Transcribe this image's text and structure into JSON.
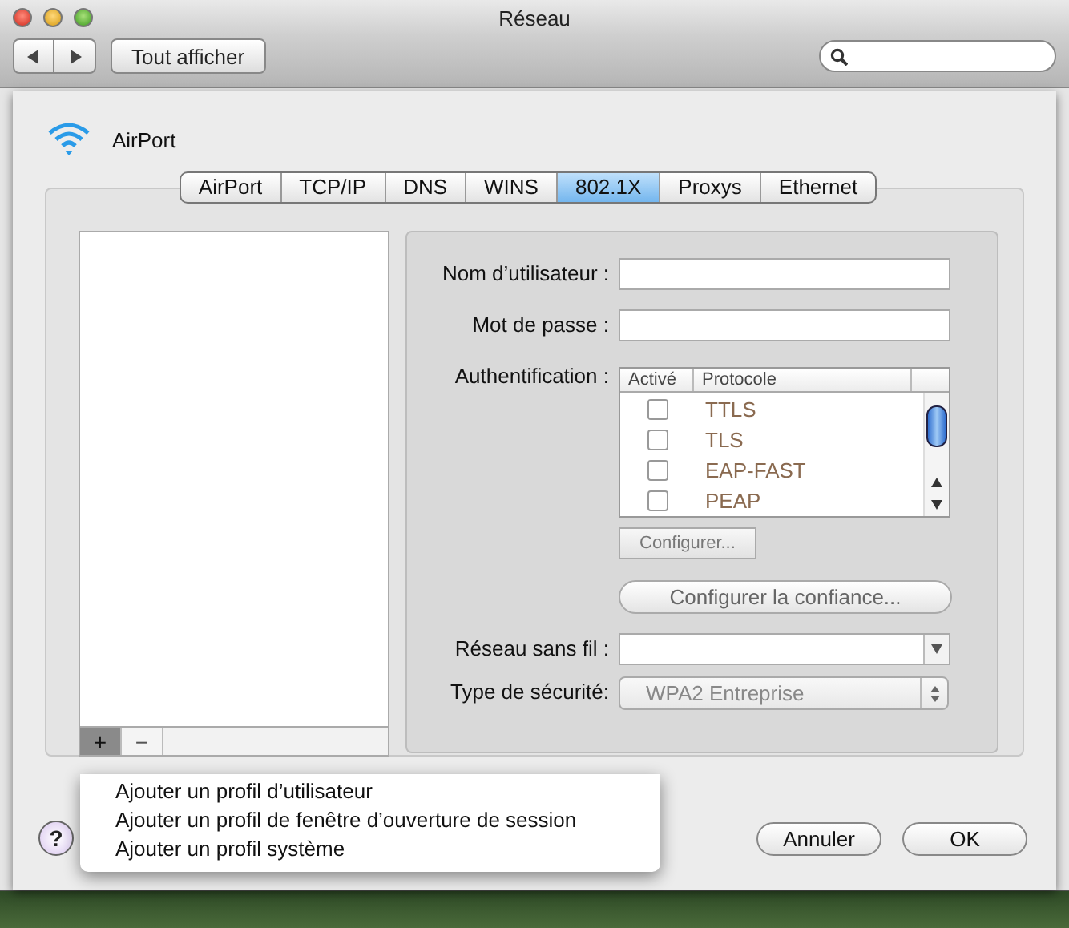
{
  "window": {
    "title": "Réseau"
  },
  "toolbar": {
    "show_all": "Tout afficher"
  },
  "service": {
    "name": "AirPort"
  },
  "tabs": [
    {
      "label": "AirPort",
      "selected": false
    },
    {
      "label": "TCP/IP",
      "selected": false
    },
    {
      "label": "DNS",
      "selected": false
    },
    {
      "label": "WINS",
      "selected": false
    },
    {
      "label": "802.1X",
      "selected": true
    },
    {
      "label": "Proxys",
      "selected": false
    },
    {
      "label": "Ethernet",
      "selected": false
    }
  ],
  "profile_list": {
    "add_button": {
      "label": "+",
      "pressed": true
    },
    "remove_button": {
      "label": "−",
      "pressed": false
    }
  },
  "form": {
    "username_label": "Nom d’utilisateur :",
    "password_label": "Mot de passe :",
    "auth_label": "Authentification :",
    "auth_table": {
      "columns": [
        "Activé",
        "Protocole"
      ],
      "disabled": true,
      "rows": [
        {
          "checked": false,
          "protocol": "TTLS"
        },
        {
          "checked": false,
          "protocol": "TLS"
        },
        {
          "checked": false,
          "protocol": "EAP-FAST"
        },
        {
          "checked": false,
          "protocol": "PEAP"
        }
      ]
    },
    "configure_button": {
      "label": "Configurer...",
      "disabled": true
    },
    "trust_button": {
      "label": "Configurer la confiance...",
      "disabled": true
    },
    "wireless_label": "Réseau sans fil :",
    "security_label": "Type de sécurité:",
    "security_popup": {
      "value": "WPA2 Entreprise",
      "disabled": true
    }
  },
  "menu": {
    "items": [
      {
        "label": "Ajouter un profil d’utilisateur"
      },
      {
        "label": "Ajouter un profil de fenêtre d’ouverture de session"
      },
      {
        "label": "Ajouter un profil système"
      }
    ]
  },
  "help_button": {
    "label": "?"
  },
  "buttons": [
    {
      "label": "Annuler"
    },
    {
      "label": "OK"
    }
  ]
}
